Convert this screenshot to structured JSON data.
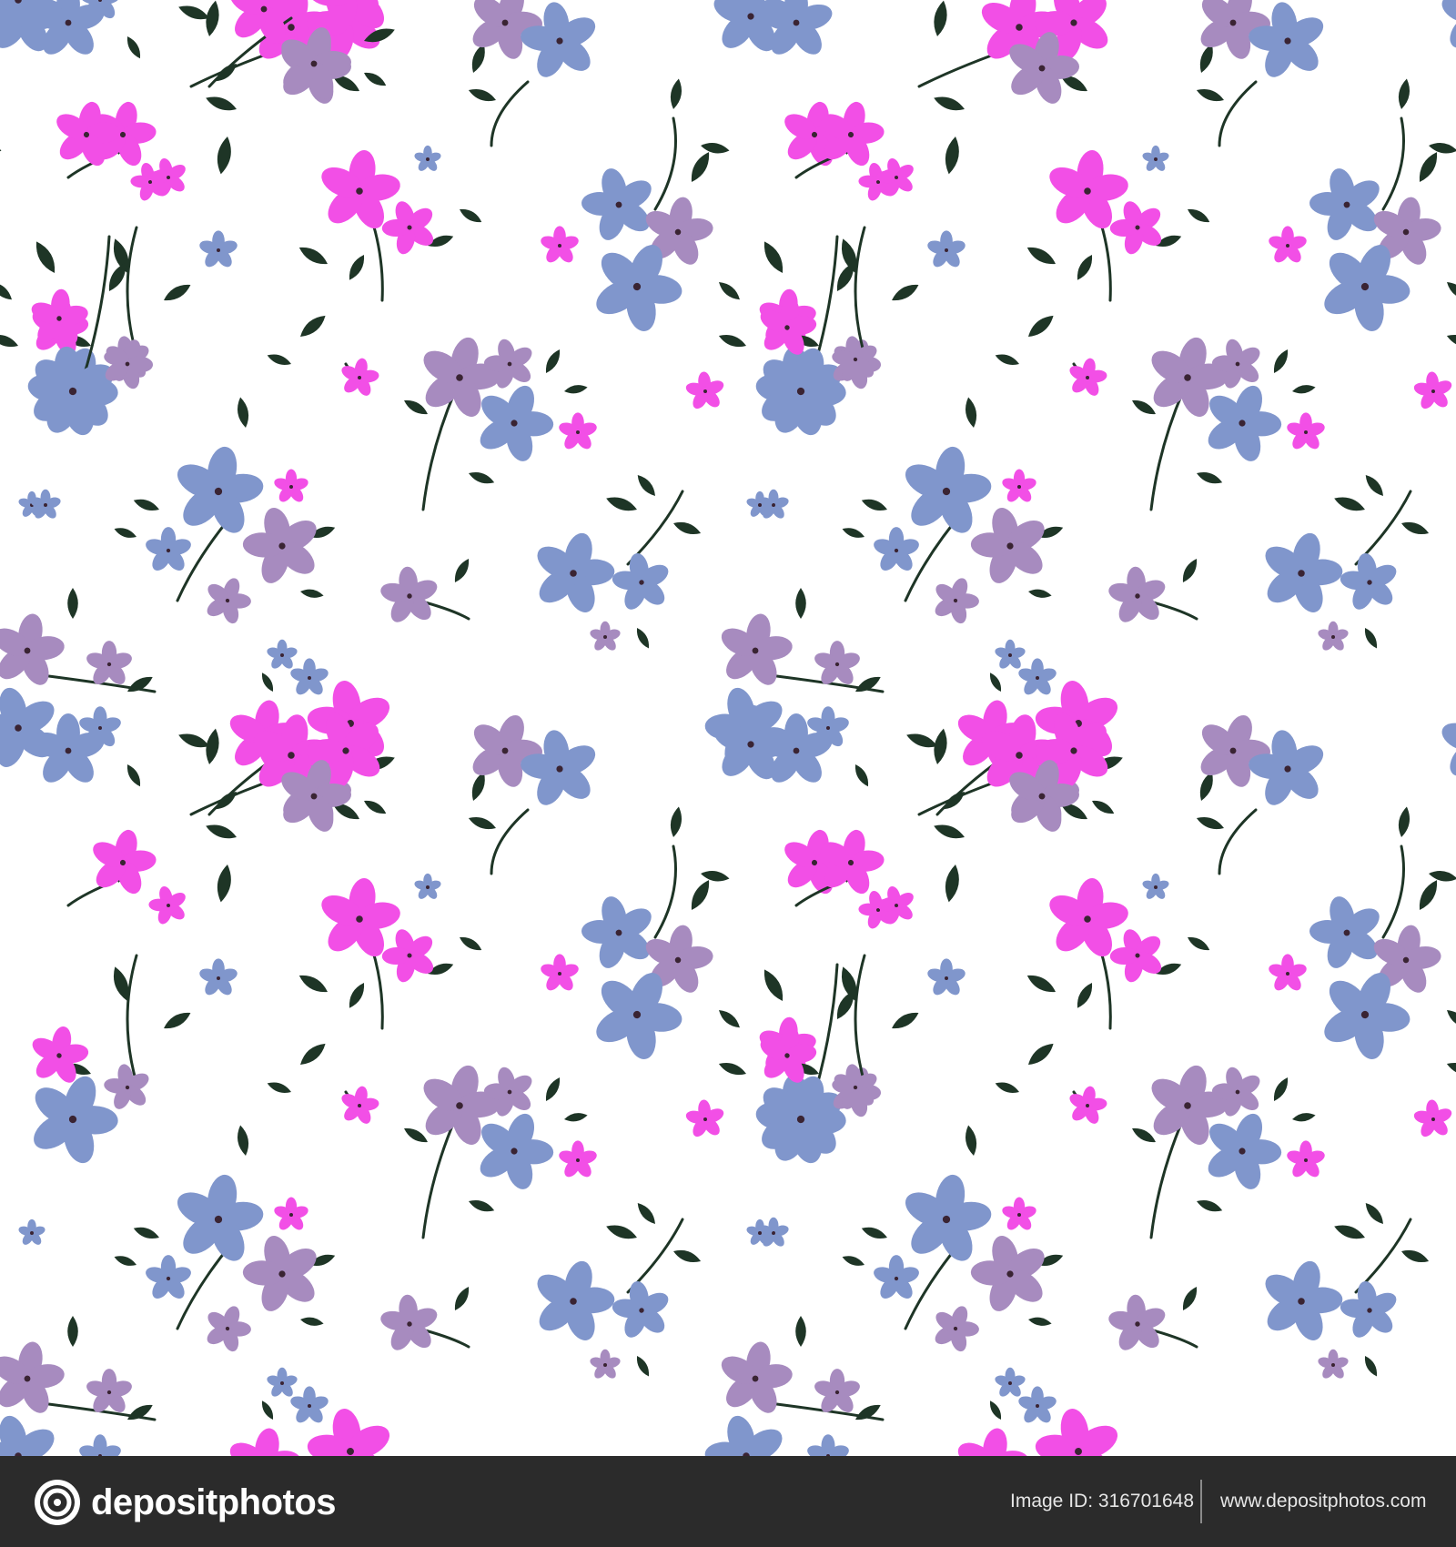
{
  "image": {
    "subject": "seamless floral pattern",
    "background_color": "#ffffff",
    "flower_colors": {
      "pink": "#f24fe6",
      "blue": "#8096cc",
      "lilac": "#a78bbf",
      "leaf": "#1e3526",
      "center": "#3a2433"
    }
  },
  "footer": {
    "background_color": "#2b2b2b",
    "brand_name": "depositphotos",
    "image_id_label": "Image ID:",
    "image_id_value": "316701648",
    "website": "www.depositphotos.com",
    "logo_icon": "camera-shutter-icon"
  }
}
